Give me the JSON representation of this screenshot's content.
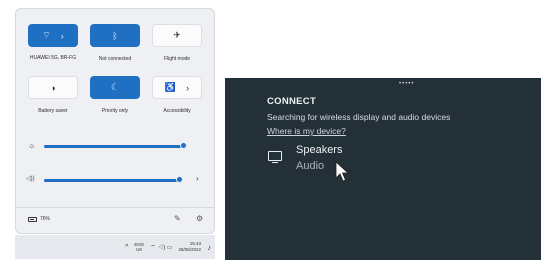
{
  "quick_settings": {
    "tiles": [
      {
        "label": "HUAWEI 5G, BR-FG",
        "icon": "wifi-icon",
        "glyph": "⌔",
        "chev": "›",
        "on": true
      },
      {
        "label": "Not connected",
        "icon": "bluetooth-icon",
        "glyph": "ᛒ",
        "chev": "",
        "on": true
      },
      {
        "label": "Flight mode",
        "icon": "airplane-icon",
        "glyph": "✈",
        "chev": "",
        "on": false
      },
      {
        "label": "Battery saver",
        "icon": "battery-saver-icon",
        "glyph": "◑",
        "chev": "",
        "on": false
      },
      {
        "label": "Priority only",
        "icon": "moon-icon",
        "glyph": "☾",
        "chev": "",
        "on": true
      },
      {
        "label": "Accessibility",
        "icon": "accessibility-icon",
        "glyph": "♿",
        "chev": "›",
        "on": false
      }
    ],
    "brightness_icon": "☼",
    "brightness_level": 1.0,
    "volume_icon": "◁))",
    "volume_level": 0.97,
    "volume_chevron": "›",
    "battery_text": "76%",
    "edit_icon": "✎",
    "settings_icon": "⚙"
  },
  "taskbar": {
    "caret": "^",
    "lang_line1": "ENG",
    "lang_line2": "UK",
    "sys_icons": "⌔ ◁) ▭",
    "time": "15:43",
    "date": "28/06/2022",
    "bell": "♪"
  },
  "connect": {
    "grip": "•••••",
    "title": "CONNECT",
    "subtitle": "Searching for wireless display and audio devices",
    "link": "Where is my device?",
    "device_name": "Speakers",
    "device_type": "Audio"
  },
  "colors": {
    "accent": "#1f6fc2",
    "panel_dark": "#233038"
  }
}
